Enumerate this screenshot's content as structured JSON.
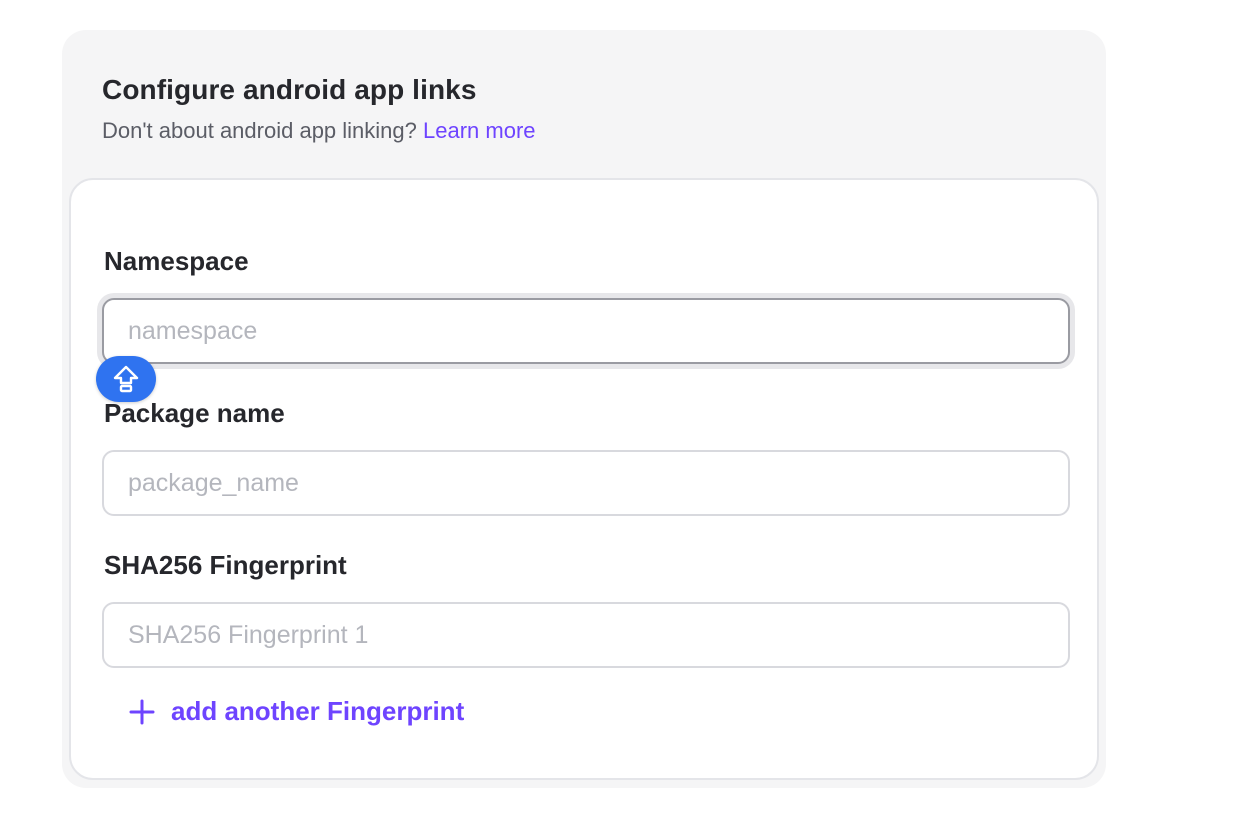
{
  "header": {
    "title": "Configure android app links",
    "subtitle": "Don't about android app linking?",
    "learn_more": "Learn more"
  },
  "form": {
    "namespace": {
      "label": "Namespace",
      "placeholder": "namespace",
      "value": ""
    },
    "package": {
      "label": "Package name",
      "placeholder": "package_name",
      "value": ""
    },
    "fingerprint": {
      "label": "SHA256 Fingerprint",
      "placeholder": "SHA256 Fingerprint 1",
      "value": ""
    },
    "add_fingerprint_label": "add another Fingerprint"
  },
  "icons": {
    "add": "plus-icon",
    "floating": "shift-arrow-icon"
  },
  "colors": {
    "accent": "#6e44ff",
    "badge": "#2f73f0",
    "outer_bg": "#f5f5f6"
  }
}
